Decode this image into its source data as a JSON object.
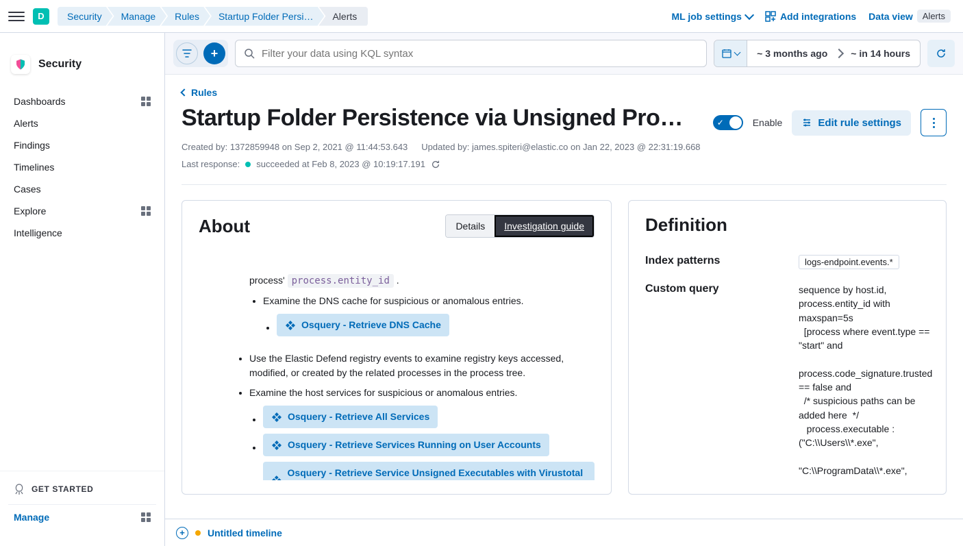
{
  "header": {
    "avatar_letter": "D",
    "breadcrumbs": [
      "Security",
      "Manage",
      "Rules",
      "Startup Folder Persi…",
      "Alerts"
    ],
    "ml_settings": "ML job settings",
    "add_integrations": "Add integrations",
    "data_view": "Data view",
    "data_view_badge": "Alerts"
  },
  "sidebar": {
    "brand": "Security",
    "items": [
      {
        "label": "Dashboards",
        "has_grid": true
      },
      {
        "label": "Alerts",
        "has_grid": false
      },
      {
        "label": "Findings",
        "has_grid": false
      },
      {
        "label": "Timelines",
        "has_grid": false
      },
      {
        "label": "Cases",
        "has_grid": false
      },
      {
        "label": "Explore",
        "has_grid": true
      },
      {
        "label": "Intelligence",
        "has_grid": false
      }
    ],
    "get_started": "GET STARTED",
    "manage": "Manage"
  },
  "filterbar": {
    "placeholder": "Filter your data using KQL syntax",
    "date_from": "~ 3 months ago",
    "date_to": "~ in 14 hours"
  },
  "page": {
    "back_label": "Rules",
    "title": "Startup Folder Persistence via Unsigned Pro…",
    "created_by": "Created by: 1372859948 on Sep 2, 2021 @ 11:44:53.643",
    "updated_by": "Updated by: james.spiteri@elastic.co on Jan 22, 2023 @ 22:31:19.668",
    "last_response_label": "Last response:",
    "last_response_value": "succeeded at Feb 8, 2023 @ 10:19:17.191",
    "enable_label": "Enable",
    "edit_button": "Edit rule settings"
  },
  "about": {
    "title": "About",
    "tab_details": "Details",
    "tab_guide": "Investigation guide",
    "body": {
      "line1_prefix": "process' ",
      "line1_code": "process.entity_id",
      "line1_suffix": " .",
      "bullet_dns": "Examine the DNS cache for suspicious or anomalous entries.",
      "osq_dns": "Osquery - Retrieve DNS Cache",
      "bullet_registry": "Use the Elastic Defend registry events to examine registry keys accessed, modified, or created by the related processes in the process tree.",
      "bullet_services": "Examine the host services for suspicious or anomalous entries.",
      "osq_all_services": "Osquery - Retrieve All Services",
      "osq_user_services": "Osquery - Retrieve Services Running on User Accounts",
      "osq_unsigned": "Osquery - Retrieve Service Unsigned Executables with Virustotal …"
    }
  },
  "definition": {
    "title": "Definition",
    "index_patterns_label": "Index patterns",
    "index_patterns_value": "logs-endpoint.events.*",
    "custom_query_label": "Custom query",
    "custom_query_value": "sequence by host.id, process.entity_id with maxspan=5s\n  [process where event.type == \"start\" and\n  process.code_signature.trusted == false and\n  /* suspicious paths can be added here  */\n   process.executable : (\"C:\\\\Users\\\\*.exe\",\n\n\"C:\\\\ProgramData\\\\*.exe\",\n                                       \"C:\\\\Windows"
  },
  "timeline": {
    "title": "Untitled timeline"
  }
}
